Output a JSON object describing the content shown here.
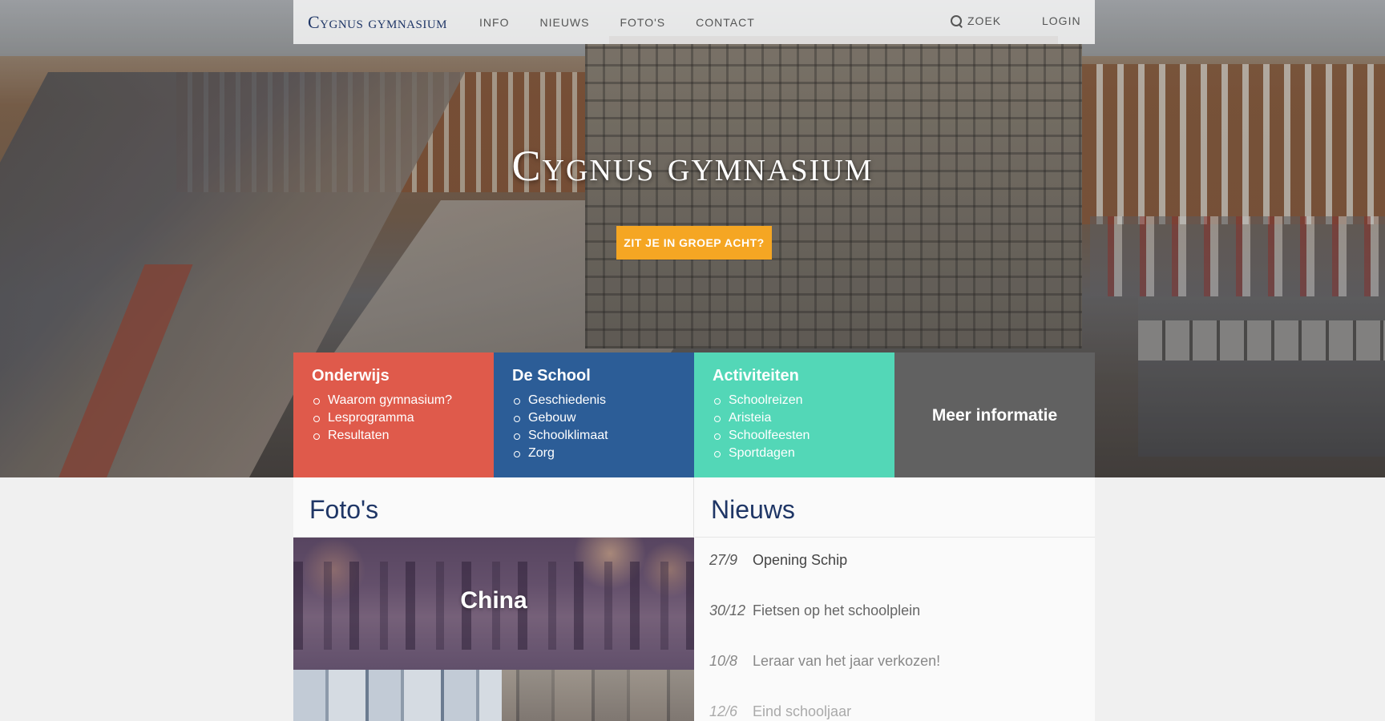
{
  "brand": "Cygnus gymnasium",
  "nav": {
    "items": [
      "INFO",
      "NIEUWS",
      "FOTO'S",
      "CONTACT"
    ],
    "search_label": "ZOEK",
    "login_label": "LOGIN"
  },
  "hero": {
    "title": "Cygnus gymnasium",
    "cta_label": "ZIT JE IN GROEP ACHT?"
  },
  "cards": [
    {
      "title": "Onderwijs",
      "color": "#df5a4b",
      "items": [
        "Waarom gymnasium?",
        "Lesprogramma",
        "Resultaten"
      ]
    },
    {
      "title": "De School",
      "color": "#2c5d97",
      "items": [
        "Geschiedenis",
        "Gebouw",
        "Schoolklimaat",
        "Zorg"
      ]
    },
    {
      "title": "Activiteiten",
      "color": "#53d7b7",
      "items": [
        "Schoolreizen",
        "Aristeia",
        "Schoolfeesten",
        "Sportdagen"
      ]
    },
    {
      "title": "Meer informatie",
      "color": "#616161"
    }
  ],
  "photos": {
    "title": "Foto's",
    "albums": [
      {
        "label": "China"
      }
    ]
  },
  "news": {
    "title": "Nieuws",
    "items": [
      {
        "date": "27/9",
        "title": "Opening Schip"
      },
      {
        "date": "30/12",
        "title": "Fietsen op het schoolplein"
      },
      {
        "date": "10/8",
        "title": "Leraar van het jaar verkozen!"
      },
      {
        "date": "12/6",
        "title": "Eind schooljaar"
      }
    ]
  },
  "colors": {
    "brand": "#1f3666",
    "accent": "#f5a623"
  }
}
